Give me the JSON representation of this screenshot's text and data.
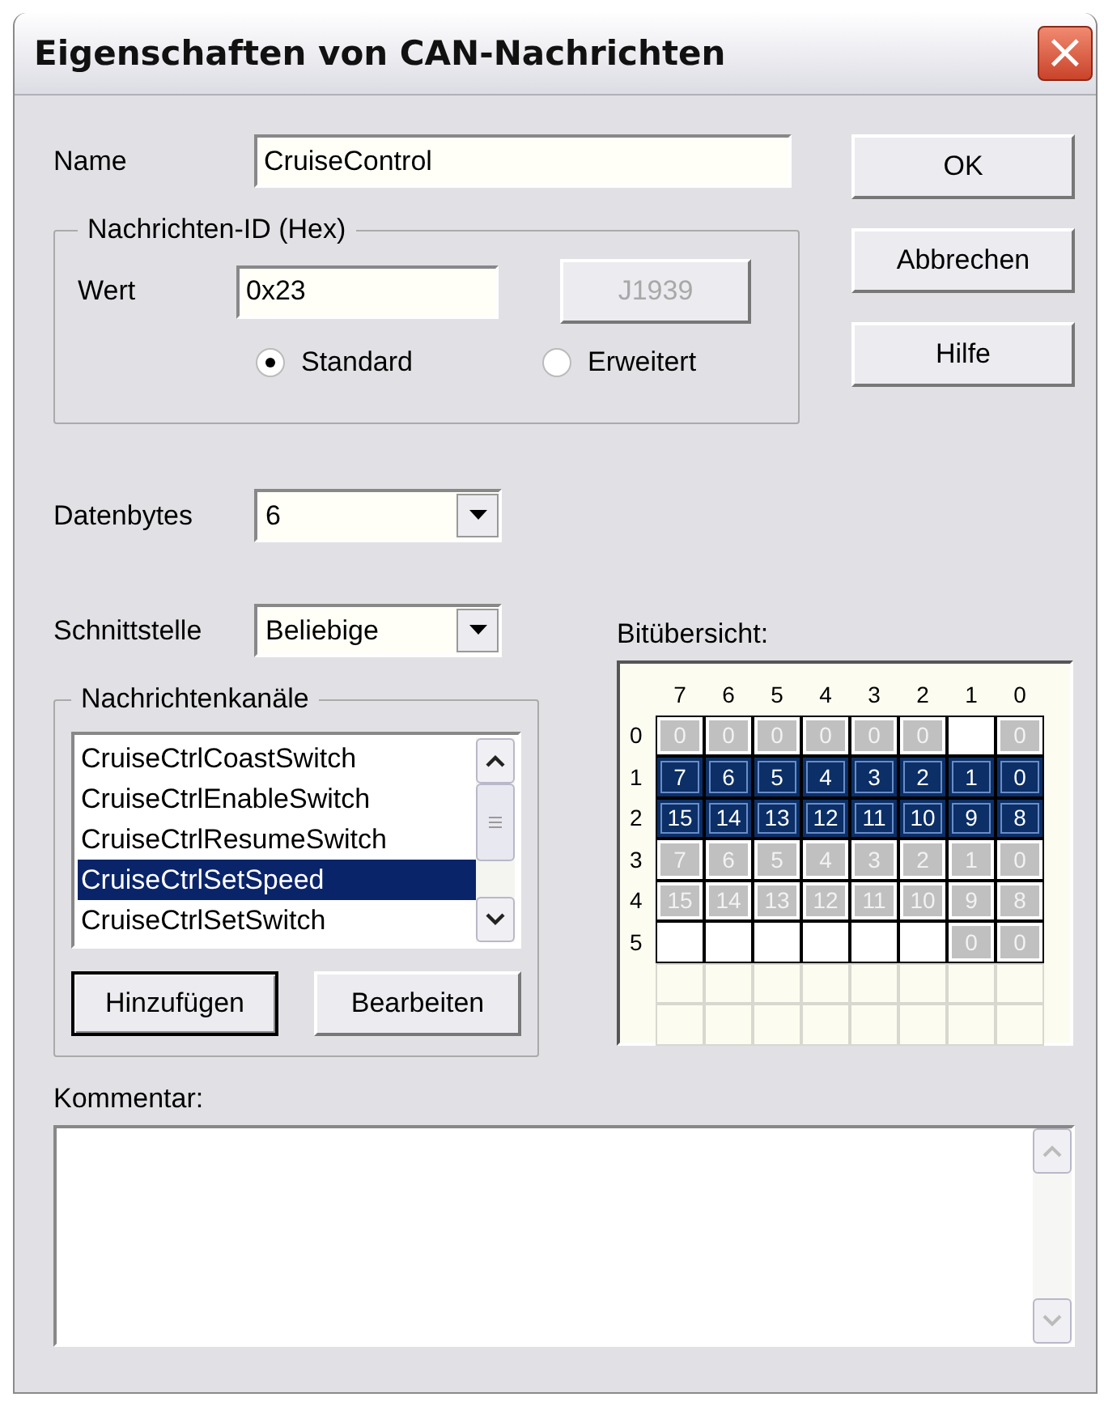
{
  "window": {
    "title": "Eigenschaften von CAN-Nachrichten",
    "close": "×"
  },
  "name": {
    "label": "Name",
    "value": "CruiseControl"
  },
  "buttons": [
    "OK",
    "Abbrechen",
    "Hilfe"
  ],
  "id_group": {
    "title": "Nachrichten-ID (Hex)",
    "value_label": "Wert",
    "value": "0x23",
    "j1939": {
      "label": "J1939",
      "disabled": true
    },
    "radios": [
      {
        "label": "Standard",
        "selected": true
      },
      {
        "label": "Erweitert",
        "selected": false
      }
    ]
  },
  "datenbytes": {
    "label": "Datenbytes",
    "value": "6"
  },
  "schnittstelle": {
    "label": "Schnittstelle",
    "value": "Beliebige"
  },
  "channels": {
    "title": "Nachrichtenkanäle",
    "items": [
      {
        "label": "CruiseCtrlCoastSwitch",
        "selected": false
      },
      {
        "label": "CruiseCtrlEnableSwitch",
        "selected": false
      },
      {
        "label": "CruiseCtrlResumeSwitch",
        "selected": false
      },
      {
        "label": "CruiseCtrlSetSpeed",
        "selected": true
      },
      {
        "label": "CruiseCtrlSetSwitch",
        "selected": false
      }
    ],
    "buttons": [
      {
        "label": "Hinzufügen",
        "default": true
      },
      {
        "label": "Bearbeiten",
        "default": false
      }
    ]
  },
  "bit_overview": {
    "title": "Bitübersicht:",
    "columns": [
      "7",
      "6",
      "5",
      "4",
      "3",
      "2",
      "1",
      "0"
    ],
    "rows": [
      {
        "label": "0",
        "cells": [
          {
            "kind": "used",
            "text": "0"
          },
          {
            "kind": "used",
            "text": "0"
          },
          {
            "kind": "used",
            "text": "0"
          },
          {
            "kind": "used",
            "text": "0"
          },
          {
            "kind": "used",
            "text": "0"
          },
          {
            "kind": "used",
            "text": "0"
          },
          {
            "kind": "empty"
          },
          {
            "kind": "used",
            "text": "0"
          }
        ]
      },
      {
        "label": "1",
        "cells": [
          {
            "kind": "selected",
            "text": "7"
          },
          {
            "kind": "selected",
            "text": "6"
          },
          {
            "kind": "selected",
            "text": "5"
          },
          {
            "kind": "selected",
            "text": "4"
          },
          {
            "kind": "selected",
            "text": "3"
          },
          {
            "kind": "selected",
            "text": "2"
          },
          {
            "kind": "selected",
            "text": "1"
          },
          {
            "kind": "selected",
            "text": "0"
          }
        ]
      },
      {
        "label": "2",
        "cells": [
          {
            "kind": "selected",
            "text": "15"
          },
          {
            "kind": "selected",
            "text": "14"
          },
          {
            "kind": "selected",
            "text": "13"
          },
          {
            "kind": "selected",
            "text": "12"
          },
          {
            "kind": "selected",
            "text": "11"
          },
          {
            "kind": "selected",
            "text": "10"
          },
          {
            "kind": "selected",
            "text": "9"
          },
          {
            "kind": "selected",
            "text": "8"
          }
        ]
      },
      {
        "label": "3",
        "cells": [
          {
            "kind": "used",
            "text": "7"
          },
          {
            "kind": "used",
            "text": "6"
          },
          {
            "kind": "used",
            "text": "5"
          },
          {
            "kind": "used",
            "text": "4"
          },
          {
            "kind": "used",
            "text": "3"
          },
          {
            "kind": "used",
            "text": "2"
          },
          {
            "kind": "used",
            "text": "1"
          },
          {
            "kind": "used",
            "text": "0"
          }
        ]
      },
      {
        "label": "4",
        "cells": [
          {
            "kind": "used",
            "text": "15"
          },
          {
            "kind": "used",
            "text": "14"
          },
          {
            "kind": "used",
            "text": "13"
          },
          {
            "kind": "used",
            "text": "12"
          },
          {
            "kind": "used",
            "text": "11"
          },
          {
            "kind": "used",
            "text": "10"
          },
          {
            "kind": "used",
            "text": "9"
          },
          {
            "kind": "used",
            "text": "8"
          }
        ]
      },
      {
        "label": "5",
        "cells": [
          {
            "kind": "empty"
          },
          {
            "kind": "empty"
          },
          {
            "kind": "empty"
          },
          {
            "kind": "empty"
          },
          {
            "kind": "empty"
          },
          {
            "kind": "empty"
          },
          {
            "kind": "used",
            "text": "0"
          },
          {
            "kind": "used",
            "text": "0"
          }
        ]
      },
      {
        "cells": [
          {
            "kind": "blank"
          },
          {
            "kind": "blank"
          },
          {
            "kind": "blank"
          },
          {
            "kind": "blank"
          },
          {
            "kind": "blank"
          },
          {
            "kind": "blank"
          },
          {
            "kind": "blank"
          },
          {
            "kind": "blank"
          }
        ]
      },
      {
        "cells": [
          {
            "kind": "blank"
          },
          {
            "kind": "blank"
          },
          {
            "kind": "blank"
          },
          {
            "kind": "blank"
          },
          {
            "kind": "blank"
          },
          {
            "kind": "blank"
          },
          {
            "kind": "blank"
          },
          {
            "kind": "blank"
          }
        ]
      }
    ]
  },
  "comment": {
    "label": "Kommentar:"
  }
}
